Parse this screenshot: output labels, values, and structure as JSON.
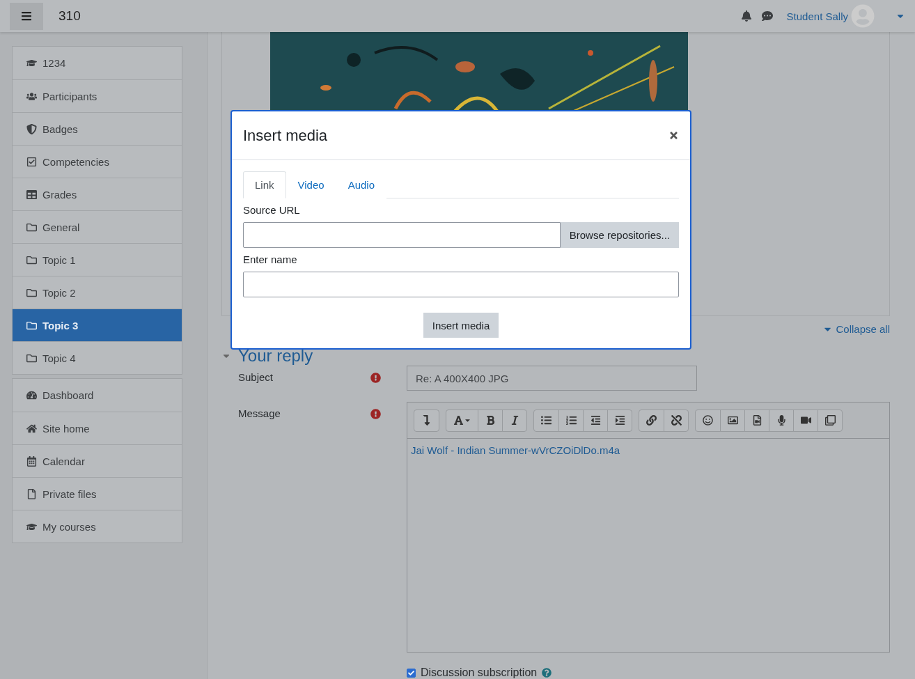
{
  "header": {
    "course": "310",
    "user": "Student Sally"
  },
  "sidebar": {
    "groups": [
      {
        "items": [
          {
            "label": "1234",
            "selected": false
          },
          {
            "label": "Participants",
            "selected": false
          },
          {
            "label": "Badges",
            "selected": false
          },
          {
            "label": "Competencies",
            "selected": false
          },
          {
            "label": "Grades",
            "selected": false
          },
          {
            "label": "General",
            "selected": false
          },
          {
            "label": "Topic 1",
            "selected": false
          },
          {
            "label": "Topic 2",
            "selected": false
          },
          {
            "label": "Topic 3",
            "selected": true
          },
          {
            "label": "Topic 4",
            "selected": false
          }
        ]
      },
      {
        "items": [
          {
            "label": "Dashboard",
            "selected": false
          },
          {
            "label": "Site home",
            "selected": false
          },
          {
            "label": "Calendar",
            "selected": false
          },
          {
            "label": "Private files",
            "selected": false
          },
          {
            "label": "My courses",
            "selected": false
          }
        ]
      }
    ]
  },
  "main": {
    "collapse_all": "Collapse all",
    "reply_heading": "Your reply",
    "form": {
      "subject_label": "Subject",
      "subject_value": "Re: A 400X400 JPG",
      "message_label": "Message",
      "message_link": "Jai Wolf - Indian Summer-wVrCZOiDlDo.m4a",
      "subscription_label": "Discussion subscription",
      "subscription_checked": true
    }
  },
  "modal": {
    "title": "Insert media",
    "tabs": [
      {
        "label": "Link",
        "selected": true
      },
      {
        "label": "Video",
        "selected": false
      },
      {
        "label": "Audio",
        "selected": false
      }
    ],
    "source_label": "Source URL",
    "browse_button": "Browse repositories...",
    "name_label": "Enter name",
    "insert_button": "Insert media"
  }
}
